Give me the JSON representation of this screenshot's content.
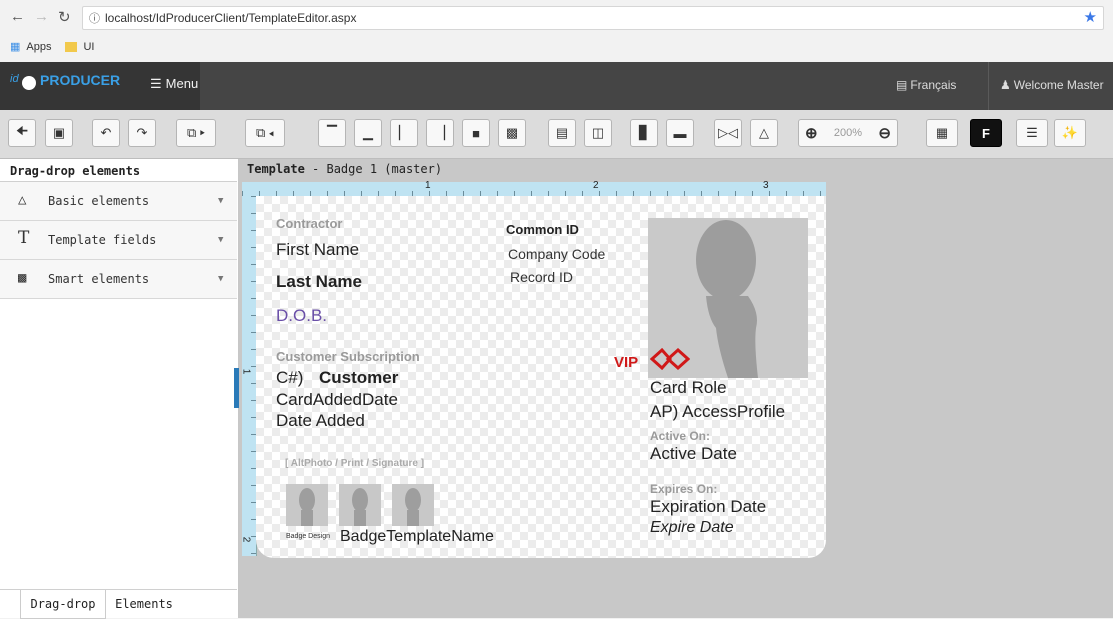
{
  "browser": {
    "url": "localhost/IdProducerClient/TemplateEditor.aspx",
    "bookmarks": [
      "Apps",
      "UI"
    ]
  },
  "header": {
    "logo_prefix": "id",
    "logo_text": "PRODUCER",
    "menu_label": "Menu",
    "language_label": "Français",
    "welcome_label": "Welcome Master"
  },
  "toolbar": {
    "zoom_value": "200%",
    "font_button_label": "F"
  },
  "left_panel": {
    "title": "Drag-drop elements",
    "sections": [
      {
        "label": "Basic elements",
        "icon": "shapes-icon"
      },
      {
        "label": "Template fields",
        "icon": "text-field-icon"
      },
      {
        "label": "Smart elements",
        "icon": "qr-code-icon"
      }
    ],
    "bottom_tabs": [
      "Drag-drop",
      "Elements"
    ]
  },
  "canvas": {
    "template_label": "Template",
    "template_name": " - Badge 1 (master)",
    "ruler_marks": [
      "1",
      "2",
      "3"
    ],
    "vruler_marks": [
      "1",
      "2"
    ]
  },
  "card": {
    "contractor": "Contractor",
    "first_name": "First Name",
    "last_name": "Last Name",
    "dob": "D.O.B.",
    "customer_subscription": "Customer Subscription",
    "customer_prefix": "C#)",
    "customer": "Customer",
    "card_added_date": "CardAddedDate",
    "date_added": "Date Added",
    "alt_photo_label": "[ AltPhoto / Print / Signature ]",
    "badge_design_label": "Badge Design",
    "badge_template_name": "BadgeTemplateName",
    "common_id": "Common ID",
    "company_code": "Company Code",
    "record_id": "Record ID",
    "vip_label": "VIP",
    "card_role": "Card Role",
    "access_profile": "AP) AccessProfile",
    "active_on_label": "Active On:",
    "active_date": "Active Date",
    "expires_on_label": "Expires On:",
    "expiration_date": "Expiration Date",
    "expire_date": "Expire Date"
  },
  "colors": {
    "app_header": "#454545",
    "accent_blue": "#2a7ab8",
    "dob_purple": "#6a4fa8",
    "vip_red": "#d01818"
  }
}
